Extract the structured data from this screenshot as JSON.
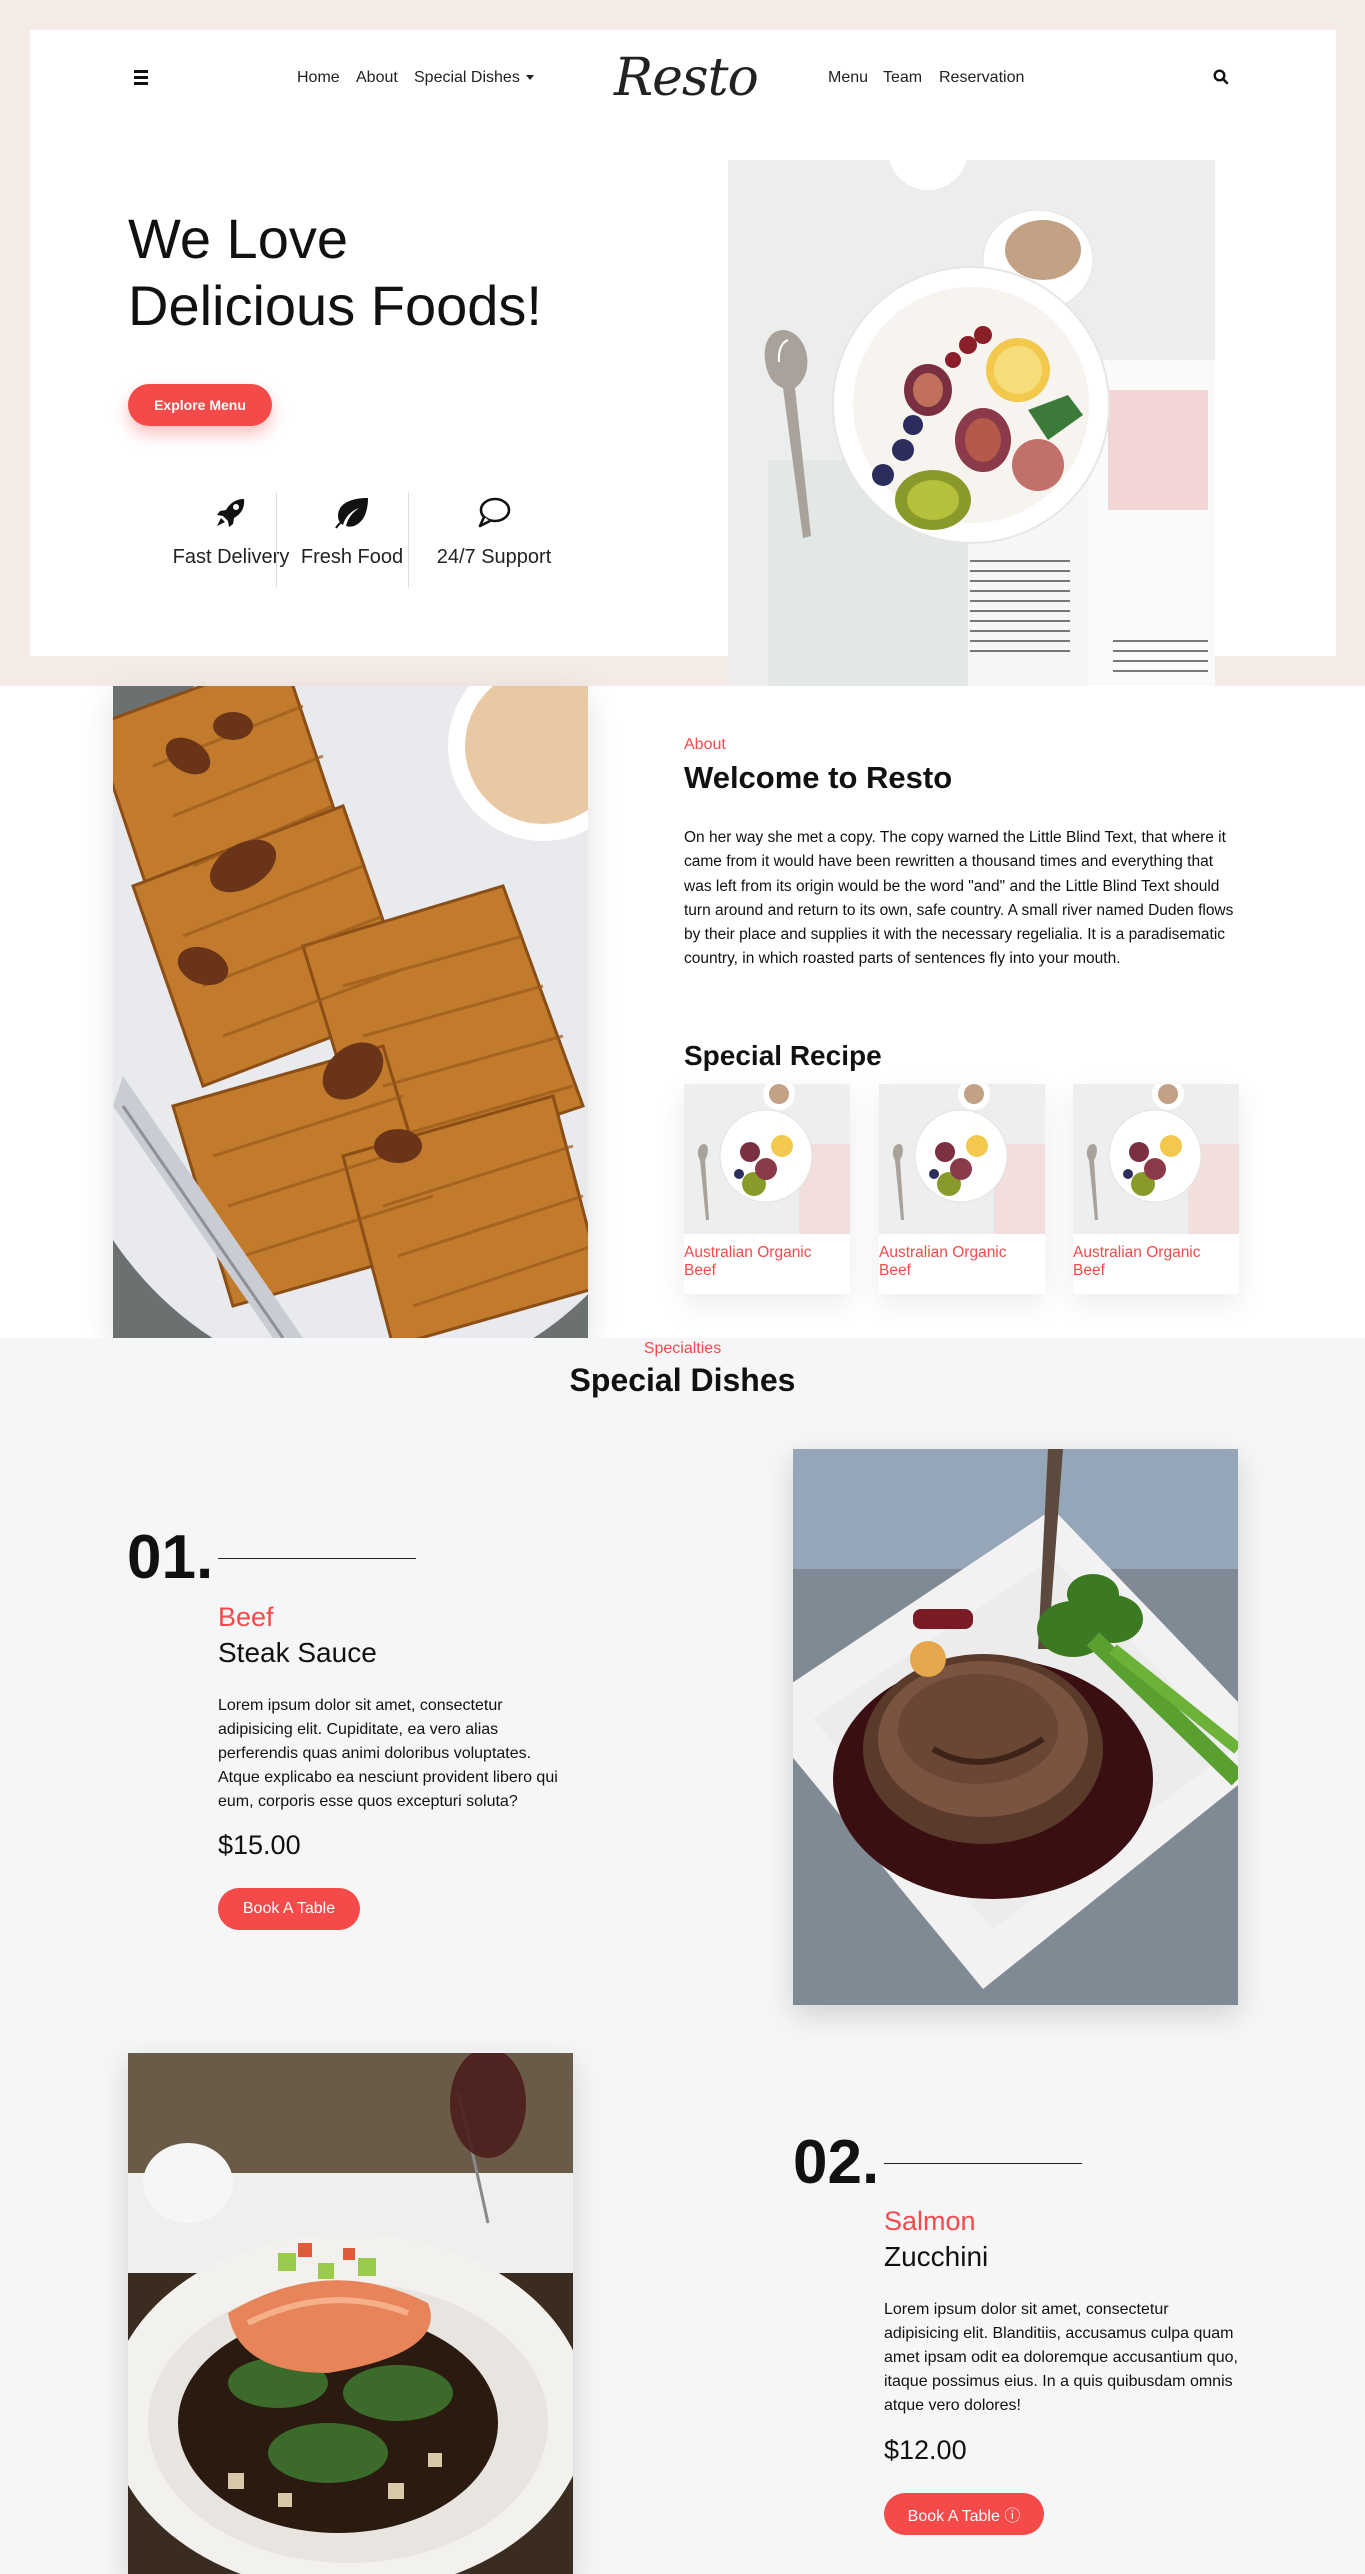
{
  "nav": {
    "left_links": [
      "Home",
      "About",
      "Special Dishes"
    ],
    "logo": "Resto",
    "right_links": [
      "Menu",
      "Team",
      "Reservation"
    ]
  },
  "hero": {
    "title_line1": "We Love",
    "title_line2": "Delicious Foods!",
    "cta": "Explore Menu",
    "features": [
      "Fast Delivery",
      "Fresh Food",
      "24/7 Support"
    ]
  },
  "about": {
    "subheading": "About",
    "title": "Welcome to Resto",
    "text": "On her way she met a copy. The copy warned the Little Blind Text, that where it came from it would have been rewritten a thousand times and everything that was left from its origin would be the word \"and\" and the Little Blind Text should turn around and return to its own, safe country. A small river named Duden flows by their place and supplies it with the necessary regelialia. It is a paradisematic country, in which roasted parts of sentences fly into your mouth.",
    "recipe_title": "Special Recipe",
    "recipes": [
      "Australian Organic Beef",
      "Australian Organic Beef",
      "Australian Organic Beef"
    ]
  },
  "specials": {
    "subheading": "Specialties",
    "title": "Special Dishes",
    "dishes": [
      {
        "number": "01.",
        "category": "Beef",
        "name": "Steak Sauce",
        "description": "Lorem ipsum dolor sit amet, consectetur adipisicing elit. Cupiditate, ea vero alias perferendis quas animi doloribus voluptates. Atque explicabo ea nesciunt provident libero qui eum, corporis esse quos excepturi soluta?",
        "price": "$15.00",
        "button": "Book A Table"
      },
      {
        "number": "02.",
        "category": "Salmon",
        "name": "Zucchini",
        "description": "Lorem ipsum dolor sit amet, consectetur adipisicing elit. Blanditiis, accusamus culpa quam amet ipsam odit ea doloremque accusantium quo, itaque possimus eius. In a quis quibusdam omnis atque vero dolores!",
        "price": "$12.00",
        "button": "Book A Table ⓘ"
      }
    ]
  },
  "colors": {
    "accent": "#f44a4a",
    "hero_bg": "#f5ebe6",
    "section_bg": "#f5f6f8"
  }
}
